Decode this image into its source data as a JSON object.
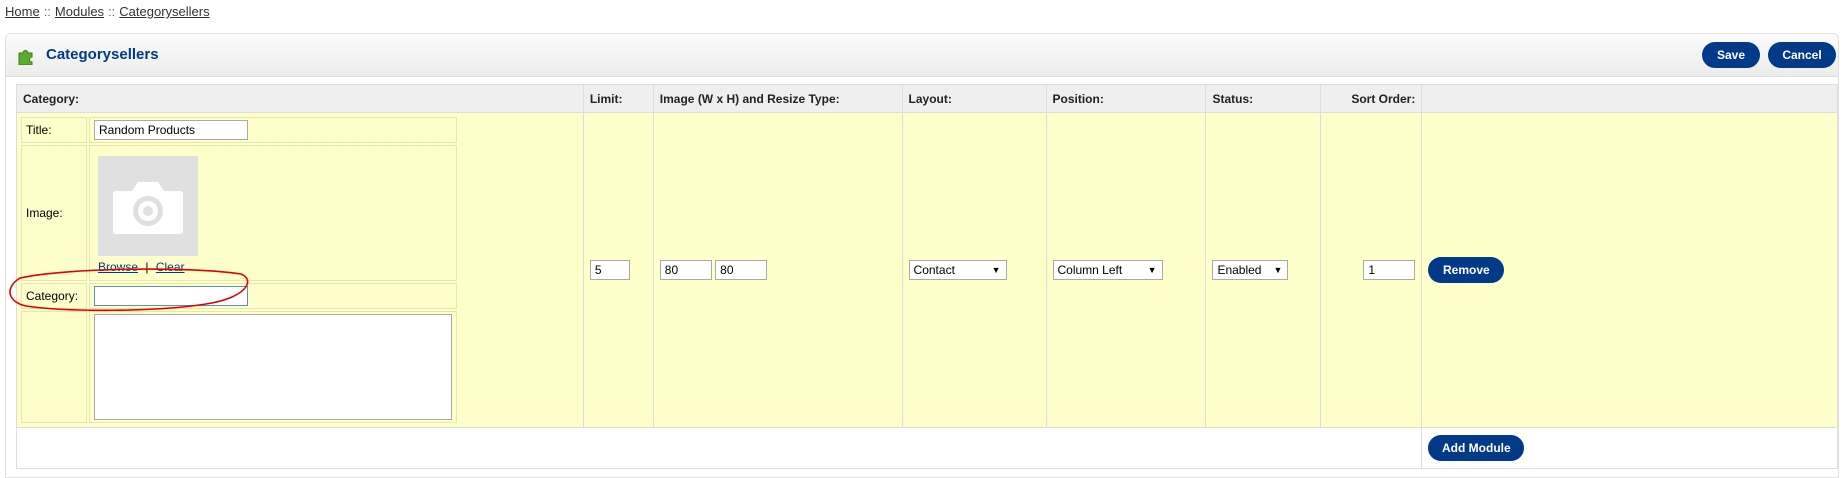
{
  "breadcrumb": {
    "home": "Home",
    "modules": "Modules",
    "current": "Categorysellers",
    "sep": "::"
  },
  "heading": {
    "title": "Categorysellers",
    "save": "Save",
    "cancel": "Cancel"
  },
  "table": {
    "headers": {
      "category": "Category:",
      "limit": "Limit:",
      "image": "Image (W x H) and Resize Type:",
      "layout": "Layout:",
      "position": "Position:",
      "status": "Status:",
      "sort_order": "Sort Order:"
    },
    "row": {
      "title_label": "Title:",
      "title_value": "Random Products",
      "image_label": "Image:",
      "browse": "Browse",
      "link_sep": "|",
      "clear": "Clear",
      "category_label": "Category:",
      "category_value": "",
      "limit": "5",
      "image_width": "80",
      "image_height": "80",
      "layout": "Contact",
      "position": "Column Left",
      "status": "Enabled",
      "sort_order": "1",
      "remove": "Remove"
    },
    "add_module": "Add Module"
  },
  "colors": {
    "accent": "#003a88",
    "row_bg": "#ffffcb",
    "annotation": "#e00000"
  }
}
